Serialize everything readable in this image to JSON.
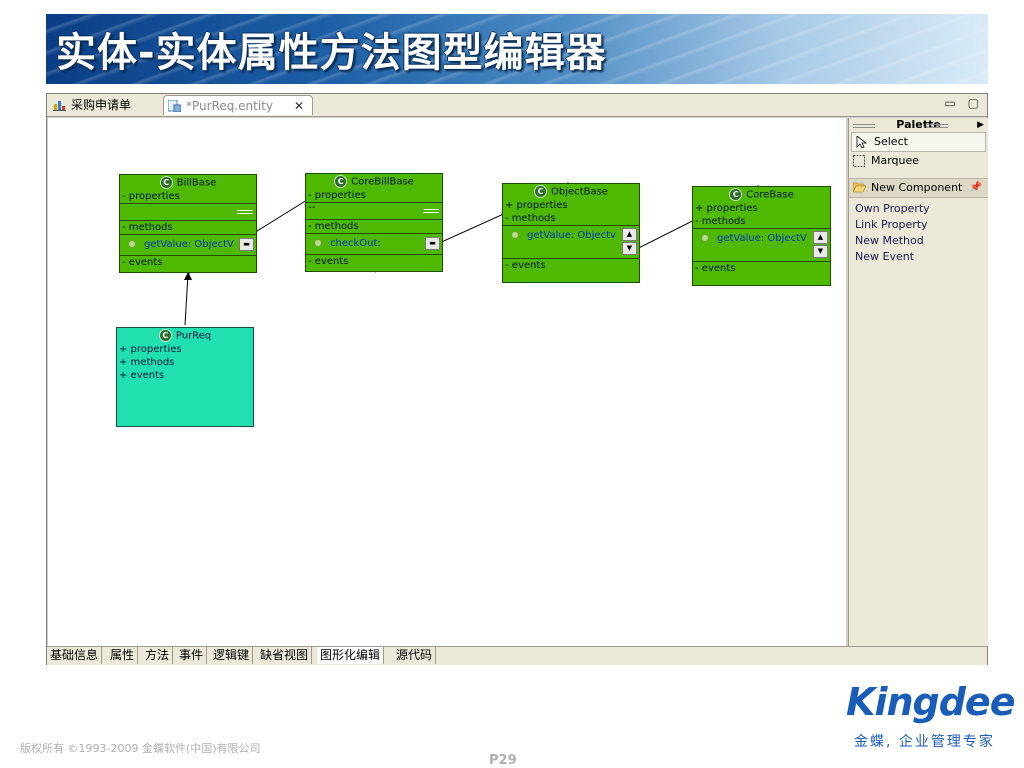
{
  "slide": {
    "title": "实体-实体属性方法图型编辑器",
    "copyright": "版权所有 ©1993-2009 金蝶软件(中国)有限公司",
    "page": "P29",
    "logo": "Kingdee",
    "slogan": "金蝶, 企业管理专家"
  },
  "editor": {
    "tabs": [
      {
        "label": "采购申请单",
        "icon": "chart-icon"
      },
      {
        "label": "*PurReq.entity",
        "icon": "entity-file-icon"
      }
    ],
    "window_controls": "▭ ▢",
    "entities": [
      {
        "name": "BillBase",
        "properties": "- properties",
        "methods": "- methods",
        "method": "getValue: ObjectV",
        "events": "- events",
        "extra": ""
      },
      {
        "name": "CoreBillBase",
        "properties": "- properties",
        "methods": "- methods",
        "method": "checkOut:",
        "events": "- events",
        "extra": "--"
      },
      {
        "name": "ObjectBase",
        "properties": "+ properties",
        "methods": "- methods",
        "method": "getValue: Objectv",
        "events": "- events",
        "extra": ""
      },
      {
        "name": "CoreBase",
        "properties": "+ properties",
        "methods": "- methods",
        "method": "getValue: ObjectV",
        "events": "- events",
        "extra": ""
      }
    ],
    "purreq": {
      "name": "PurReq",
      "properties": "+ properties",
      "methods": "+ methods",
      "events": "+ events"
    },
    "palette": {
      "title": "Palette",
      "tools": [
        {
          "label": "Select",
          "icon": "arrow-pointer-icon"
        },
        {
          "label": "Marquee",
          "icon": "marquee-icon"
        }
      ],
      "group": "New Component",
      "components": [
        "Own Property",
        "Link Property",
        "New Method",
        "New Event"
      ]
    },
    "bottom_tabs": [
      "基础信息",
      "属性",
      "方法",
      "事件",
      "逻辑键",
      "缺省视图",
      "图形化编辑",
      "源代码"
    ],
    "active_bottom_tab": "图形化编辑"
  }
}
